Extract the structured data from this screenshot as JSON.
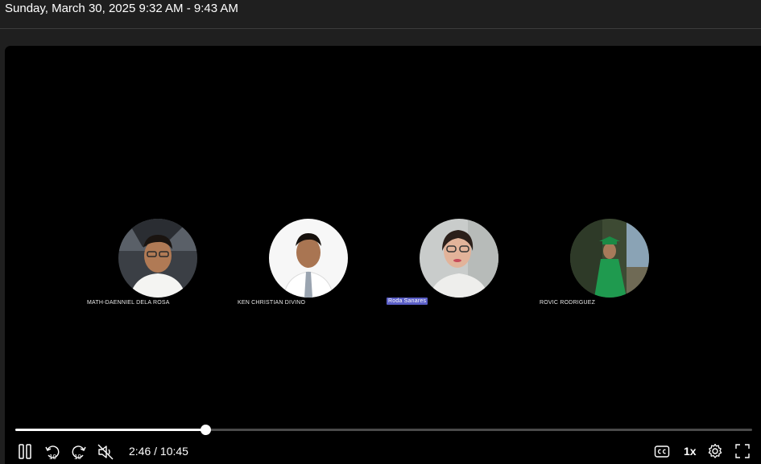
{
  "header": {
    "title": "Sunday, March 30, 2025 9:32 AM - 9:43 AM"
  },
  "participants": [
    {
      "name": "MATH-DAENNIEL DELA ROSA",
      "highlighted": false
    },
    {
      "name": "KEN CHRISTIAN DIVINO",
      "highlighted": false
    },
    {
      "name": "Roda Sanares",
      "highlighted": true
    },
    {
      "name": "ROVIC RODRIGUEZ",
      "highlighted": false
    }
  ],
  "player": {
    "time_display": "2:46 / 10:45",
    "progress_fraction": 0.2574,
    "speed_label": "1x",
    "skip_back_label": "10",
    "skip_forward_label": "10"
  },
  "icons": {
    "pause": "pause-icon",
    "skip_back": "skip-back-10-icon",
    "skip_forward": "skip-forward-10-icon",
    "mute": "muted-speaker-icon",
    "captions": "closed-captions-icon",
    "settings": "gear-icon",
    "fullscreen": "fullscreen-icon"
  },
  "colors": {
    "background": "#1f1f1f",
    "video": "#000000",
    "name_highlight": "#5b5fc7"
  }
}
